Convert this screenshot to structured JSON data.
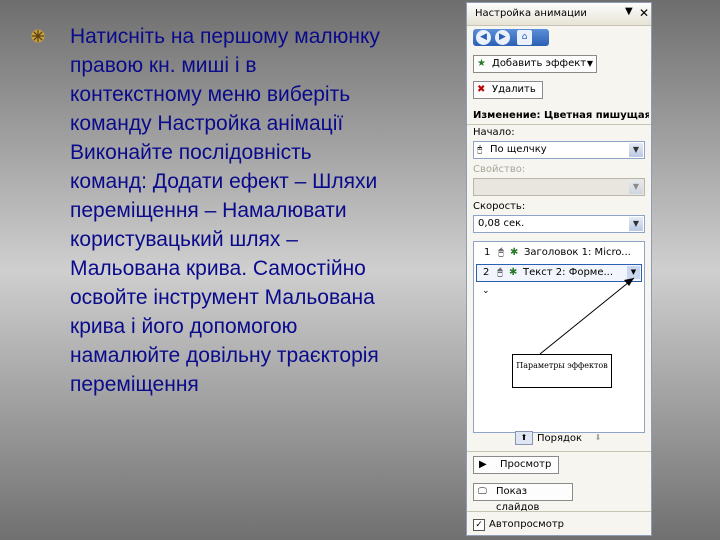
{
  "slide": {
    "lines": [
      "Натисніть на першому малюнку",
      "правою кн. миші і в",
      "контекстному меню виберіть",
      "команду Настройка анімації",
      "Виконайте послідовність",
      "команд: Додати ефект – Шляхи",
      "переміщення – Намалювати",
      "користувацький шлях –",
      "Мальована крива. Самостійно",
      "освойте інструмент Мальована",
      "крива і його допомогою",
      "намалюйте довільну траєкторія",
      "переміщення"
    ],
    "text_color": "#0a0a8c",
    "bullet_color": "#c8a040"
  },
  "pane": {
    "title": "Настройка анимации",
    "add_effect": "Добавить эффект",
    "remove": "Удалить",
    "change_label": "Изменение: Цветная пишущая м",
    "start_label": "Начало:",
    "start_value": "По щелчку",
    "property_label": "Свойство:",
    "speed_label": "Скорость:",
    "speed_value": "0,08 сек.",
    "items": [
      {
        "num": "1",
        "text": "Заголовок 1: Micro..."
      },
      {
        "num": "2",
        "text": "Текст 2: Форме..."
      }
    ],
    "callout": "Параметры эффектов",
    "order_label": "Порядок",
    "preview": "Просмотр",
    "slideshow": "Показ слайдов",
    "autopreview": "Автопросмотр"
  }
}
